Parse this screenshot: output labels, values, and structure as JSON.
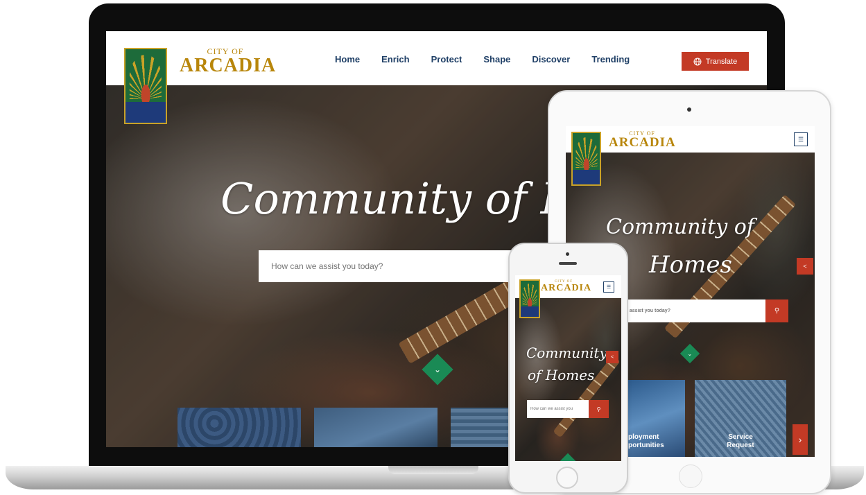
{
  "site": {
    "logo_small": "CITY OF",
    "logo_big": "ARCADIA",
    "nav": [
      "Home",
      "Enrich",
      "Protect",
      "Shape",
      "Discover",
      "Trending"
    ],
    "translate_label": "Translate",
    "hero_title_desktop": "Community of F",
    "hero_title_tablet_line1": "Community of",
    "hero_title_tablet_line2": "Homes",
    "hero_title_phone_line1": "Community",
    "hero_title_phone_line2": "of Homes",
    "search_placeholder_desktop": "How can we assist you today?",
    "search_placeholder_tablet": "e assist you today?",
    "search_placeholder_phone": "How can we assist you",
    "tiles_tablet": [
      {
        "label_line1": "ployment",
        "label_line2": "portunities"
      },
      {
        "label_line1": "Service",
        "label_line2": "Request"
      }
    ]
  },
  "colors": {
    "brand_gold": "#b8860b",
    "nav_blue": "#1f3f66",
    "accent_red": "#c33a25",
    "accent_green": "#1a8a55"
  },
  "icons": {
    "translate": "globe-icon",
    "search": "search-icon",
    "scroll_down": "chevron-down-icon",
    "share": "share-icon",
    "menu": "hamburger-icon",
    "next": "chevron-right-icon"
  }
}
